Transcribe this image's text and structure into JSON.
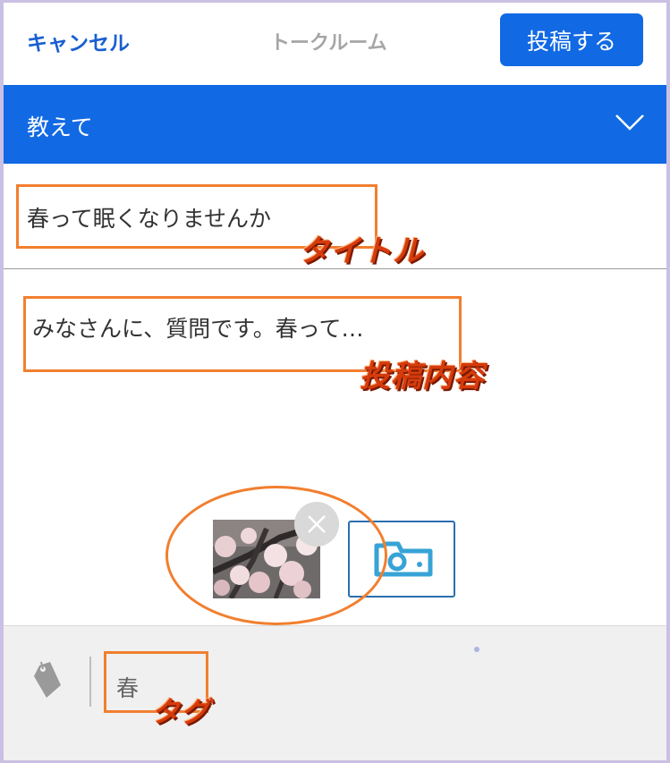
{
  "header": {
    "cancel_label": "キャンセル",
    "title": "トークルーム",
    "post_label": "投稿する"
  },
  "category": {
    "selected": "教えて",
    "icon": "chevron-down-icon"
  },
  "post": {
    "title": "春って眠くなりませんか",
    "body": "みなさんに、質問です。春って…"
  },
  "attachments": {
    "images": [
      {
        "alt": "桜の写真",
        "remove_icon": "close-icon"
      }
    ],
    "add_icon": "camera-icon"
  },
  "tags": {
    "icon": "tag-icon",
    "value": "春"
  },
  "annotations": {
    "title": "タイトル",
    "body": "投稿内容",
    "tag": "タグ"
  },
  "colors": {
    "brand_blue": "#1169e4",
    "link_blue": "#1a5fd0",
    "annotation_orange": "#f17f2f",
    "annotation_text": "#d63b0c"
  }
}
